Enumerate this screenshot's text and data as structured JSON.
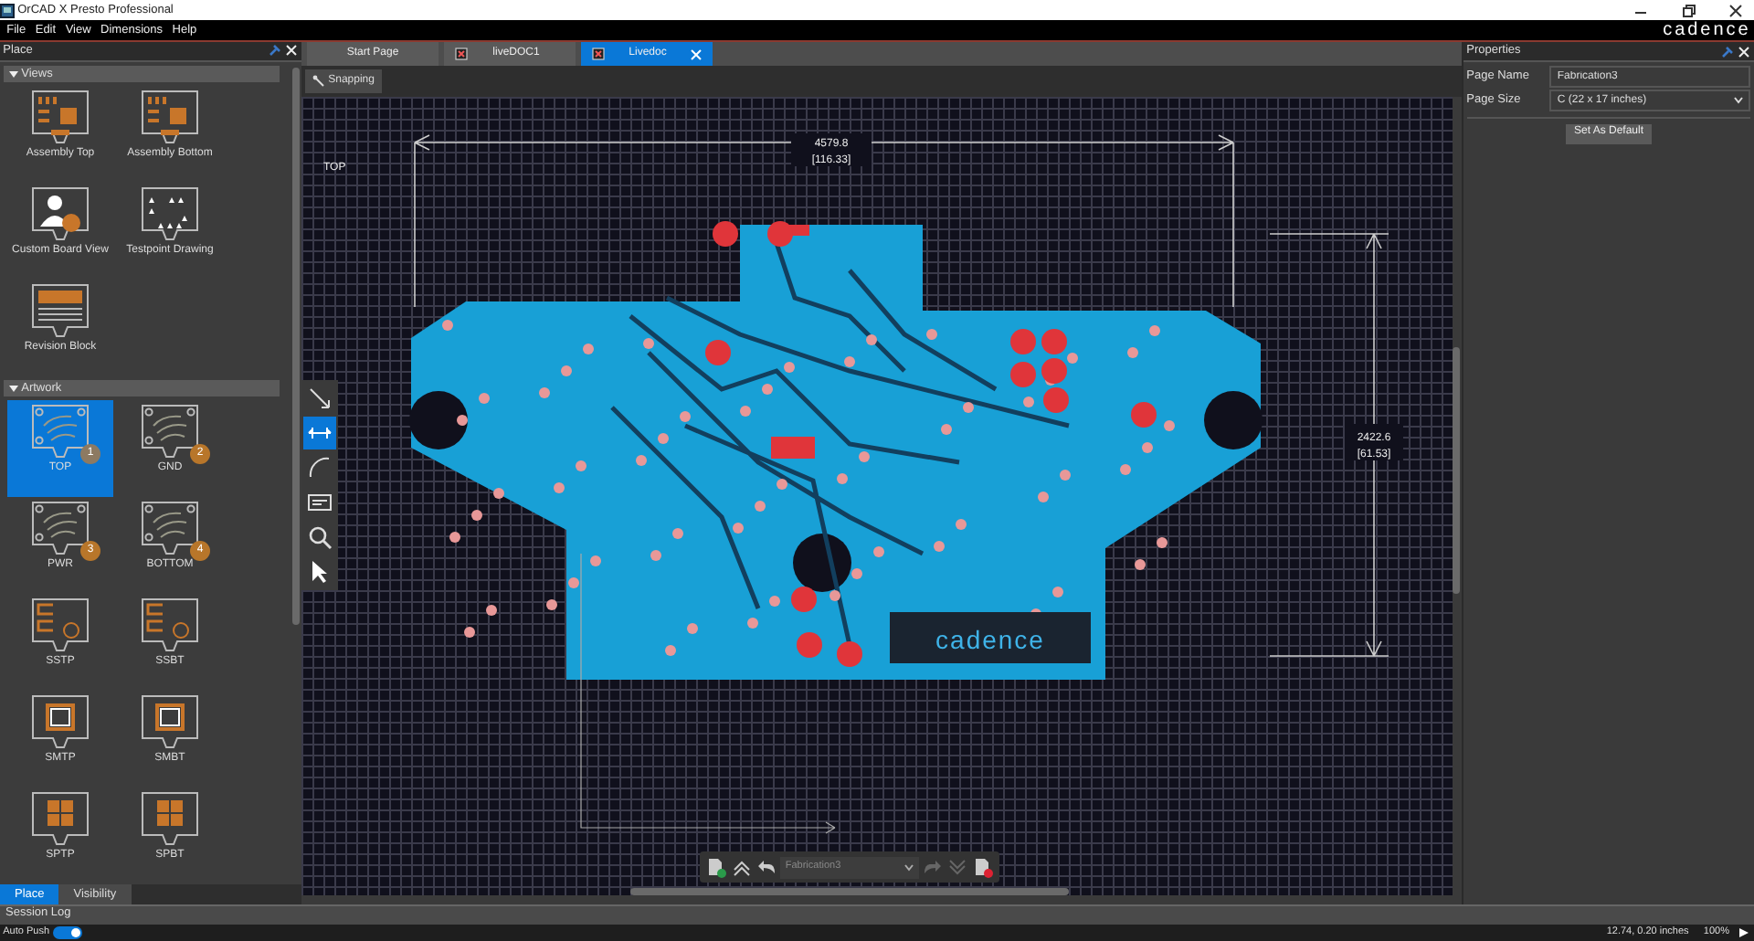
{
  "window": {
    "title": "OrCAD X Presto Professional",
    "brand": "cadence"
  },
  "menu": [
    "File",
    "Edit",
    "View",
    "Dimensions",
    "Help"
  ],
  "place_panel": {
    "title": "Place",
    "sections": [
      {
        "title": "Views",
        "expanded": true,
        "items": [
          {
            "label": "Assembly Top",
            "kind": "assembly",
            "selected": false
          },
          {
            "label": "Assembly Bottom",
            "kind": "assembly",
            "selected": false
          },
          {
            "label": "Custom Board View",
            "kind": "custom",
            "selected": false
          },
          {
            "label": "Testpoint Drawing",
            "kind": "testpoint",
            "selected": false
          },
          {
            "label": "Revision Block",
            "kind": "revision",
            "selected": false
          }
        ]
      },
      {
        "title": "Artwork",
        "expanded": true,
        "items": [
          {
            "label": "TOP",
            "kind": "layer",
            "badge": "1",
            "selected": true
          },
          {
            "label": "GND",
            "kind": "layer",
            "badge": "2",
            "selected": false
          },
          {
            "label": "PWR",
            "kind": "layer",
            "badge": "3",
            "selected": false
          },
          {
            "label": "BOTTOM",
            "kind": "layer",
            "badge": "4",
            "selected": false
          },
          {
            "label": "SSTP",
            "kind": "silkscreen",
            "selected": false
          },
          {
            "label": "SSBT",
            "kind": "silkscreen",
            "selected": false
          },
          {
            "label": "SMTP",
            "kind": "soldermask",
            "selected": false
          },
          {
            "label": "SMBT",
            "kind": "soldermask",
            "selected": false
          },
          {
            "label": "SPTP",
            "kind": "solderpaste",
            "selected": false
          },
          {
            "label": "SPBT",
            "kind": "solderpaste",
            "selected": false
          }
        ]
      }
    ]
  },
  "panel_tabs": [
    {
      "label": "Place",
      "selected": true
    },
    {
      "label": "Visibility",
      "selected": false
    }
  ],
  "doc_tabs": [
    {
      "label": "Start Page",
      "selected": false,
      "has_icon": false,
      "closable": false
    },
    {
      "label": "liveDOC1",
      "selected": false,
      "has_icon": true,
      "closable": false
    },
    {
      "label": "Livedoc",
      "selected": true,
      "has_icon": true,
      "closable": true
    }
  ],
  "snapping_button": "Snapping",
  "canvas": {
    "layer_label": "TOP",
    "width_dimension": {
      "value": "4579.8",
      "metric": "[116.33]"
    },
    "height_dimension": {
      "value": "2422.6",
      "metric": "[61.53]"
    },
    "board_logo": "cadence",
    "tools": [
      {
        "kind": "line",
        "selected": false
      },
      {
        "kind": "dimension",
        "selected": true
      },
      {
        "kind": "arc",
        "selected": false
      },
      {
        "kind": "text",
        "selected": false
      },
      {
        "kind": "zoom",
        "selected": false
      },
      {
        "kind": "pointer",
        "selected": false
      }
    ],
    "page_selector": "Fabrication3"
  },
  "properties": {
    "title": "Properties",
    "fields": [
      {
        "label": "Page Name",
        "kind": "text",
        "value": "Fabrication3"
      },
      {
        "label": "Page Size",
        "kind": "select",
        "value": "C (22 x 17 inches)"
      }
    ],
    "button": "Set As Default"
  },
  "session_log": "Session Log",
  "status_bar": {
    "auto_push": {
      "label": "Auto Push",
      "on": true
    },
    "coordinates": "12.74, 0.20 inches",
    "zoom": "100%"
  }
}
